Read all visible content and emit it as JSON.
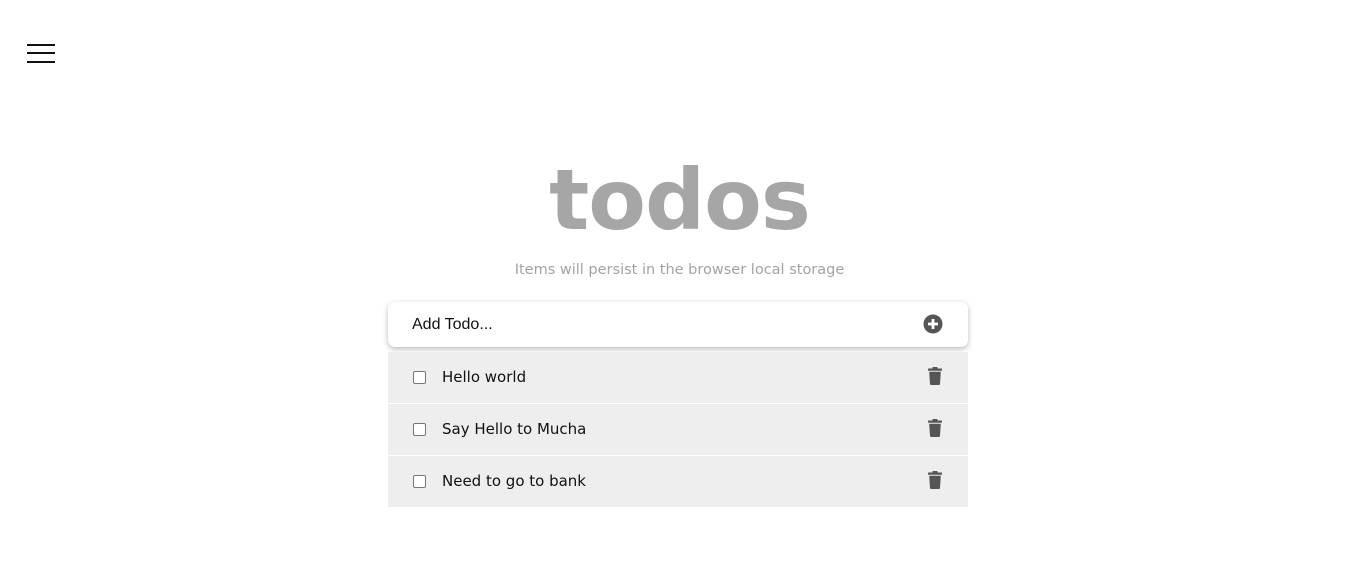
{
  "app": {
    "title": "todos",
    "subtitle": "Items will persist in the browser local storage"
  },
  "add_todo": {
    "placeholder": "Add Todo...",
    "add_icon": "plus-circle-icon"
  },
  "todos": [
    {
      "text": "Hello world",
      "done": false
    },
    {
      "text": "Say Hello to Mucha",
      "done": false
    },
    {
      "text": "Need to go to bank",
      "done": false
    }
  ],
  "icons": {
    "menu": "hamburger-menu-icon",
    "delete": "trash-icon"
  },
  "colors": {
    "title": "#a6a6a6",
    "item_background": "#eeeeee",
    "icon": "#555555"
  }
}
